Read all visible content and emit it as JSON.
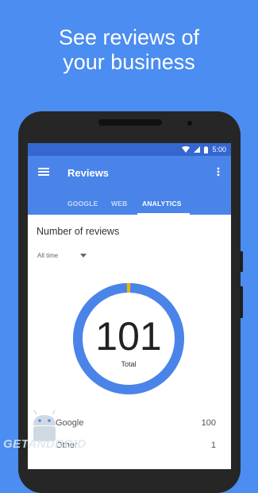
{
  "promo": {
    "line1": "See reviews of",
    "line2": "your business"
  },
  "status_bar": {
    "time": "5:00"
  },
  "app_bar": {
    "title": "Reviews"
  },
  "tabs": [
    {
      "label": "GOOGLE",
      "active": false
    },
    {
      "label": "WEB",
      "active": false
    },
    {
      "label": "ANALYTICS",
      "active": true
    }
  ],
  "content": {
    "section_title": "Number of reviews",
    "time_filter": "All time",
    "total": "101",
    "total_label": "Total"
  },
  "chart_data": {
    "type": "pie",
    "categories": [
      "Google",
      "Other"
    ],
    "values": [
      100,
      1
    ],
    "colors": [
      "#4a84e8",
      "#f5b400"
    ]
  },
  "rows": [
    {
      "name": "Google",
      "value": "100"
    },
    {
      "name": "Other",
      "value": "1"
    }
  ],
  "watermark": {
    "text": "GETANDROID"
  },
  "icons": {
    "status": [
      "wifi-icon",
      "signal-icon",
      "battery-icon"
    ],
    "app_bar": [
      "menu-icon",
      "more-vert-icon"
    ],
    "filter": "dropdown-caret-icon"
  }
}
